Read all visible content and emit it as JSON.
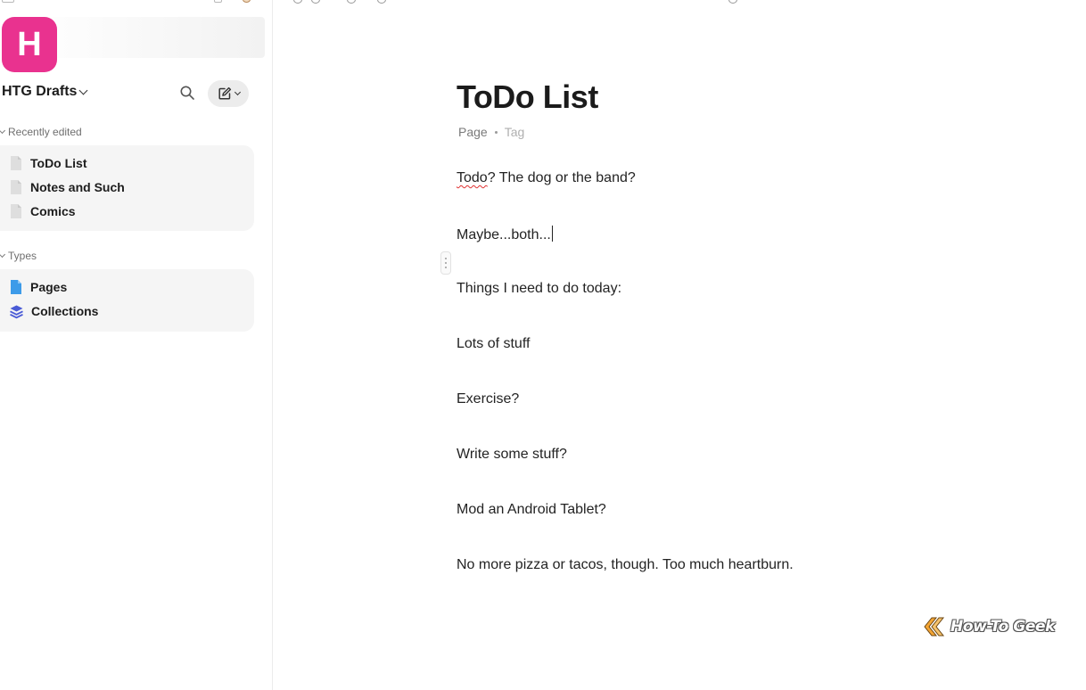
{
  "sidebar": {
    "space_initial": "H",
    "space_name": "HTG Drafts",
    "recent_label": "Recently edited",
    "recent_items": [
      {
        "label": "ToDo List"
      },
      {
        "label": "Notes and Such"
      },
      {
        "label": "Comics"
      }
    ],
    "types_label": "Types",
    "type_items": [
      {
        "label": "Pages",
        "icon": "page-blue-icon"
      },
      {
        "label": "Collections",
        "icon": "layers-icon"
      }
    ]
  },
  "document": {
    "title": "ToDo List",
    "meta_type": "Page",
    "meta_tag": "Tag",
    "paragraphs": [
      {
        "misspelled": "Todo",
        "rest": "? The dog or the band?"
      },
      {
        "text": "Maybe...both..."
      },
      {
        "text": "Things I need to do today:"
      },
      {
        "text": "Lots of stuff"
      },
      {
        "text": "Exercise?"
      },
      {
        "text": "Write some stuff?"
      },
      {
        "text": "Mod an Android Tablet?"
      },
      {
        "text": "No more pizza or tacos, though. Too much heartburn."
      }
    ]
  },
  "watermark": {
    "text": "How-To Geek"
  },
  "colors": {
    "space_logo": "#e9328f",
    "pages_icon": "#3d9be9",
    "collections_icon": "#4a5bd6",
    "spellcheck": "#e03030"
  }
}
